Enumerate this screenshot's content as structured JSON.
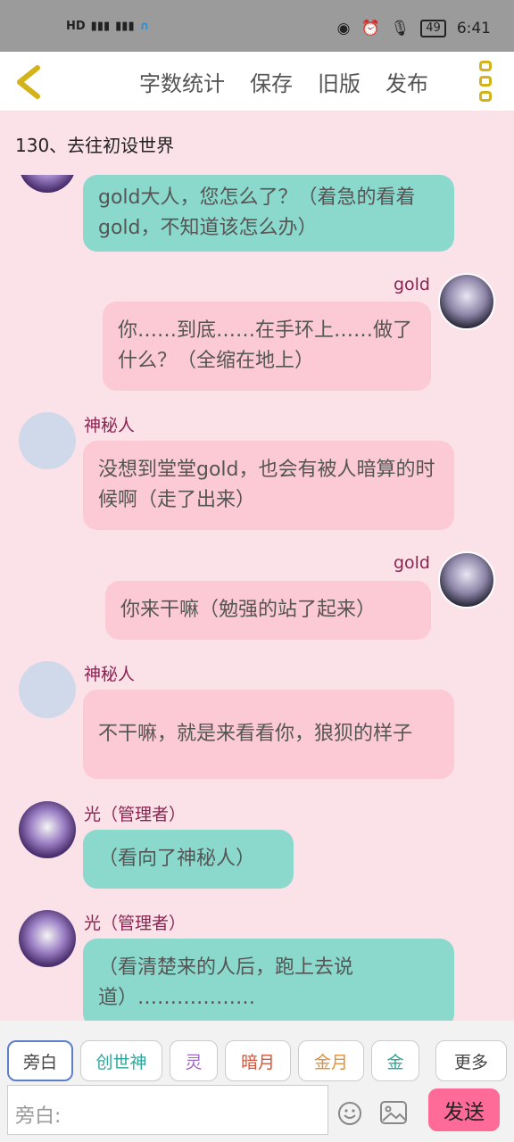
{
  "status": {
    "left": "HD",
    "time": "6:41",
    "battery": "49"
  },
  "toolbar": {
    "items": [
      "字数统计",
      "保存",
      "旧版",
      "发布"
    ]
  },
  "chapter": {
    "title": "130、去往初设世界"
  },
  "messages": [
    {
      "side": "left",
      "name": "",
      "text": "gold大人，您怎么了？（着急的看着gold，不知道该怎么办）",
      "color": "teal"
    },
    {
      "side": "right",
      "name": "gold",
      "text": "你……到底……在手环上……做了什么？（全缩在地上）",
      "color": "pink"
    },
    {
      "side": "left",
      "name": "神秘人",
      "text": "没想到堂堂gold，也会有被人暗算的时候啊（走了出来）",
      "color": "pink"
    },
    {
      "side": "right",
      "name": "gold",
      "text": "你来干嘛（勉强的站了起来）",
      "color": "pink"
    },
    {
      "side": "left",
      "name": "神秘人",
      "text": "不干嘛，就是来看看你，狼狈的样子",
      "color": "pink"
    },
    {
      "side": "left",
      "name": "光（管理者）",
      "text": "（看向了神秘人）",
      "color": "teal"
    },
    {
      "side": "left",
      "name": "光（管理者）",
      "text": "（看清楚来的人后，跑上去说道）………………",
      "color": "teal"
    }
  ],
  "roles": [
    {
      "label": "旁白",
      "color": "#444444"
    },
    {
      "label": "创世神",
      "color": "#2ea59a"
    },
    {
      "label": "灵",
      "color": "#a067c9"
    },
    {
      "label": "暗月",
      "color": "#d5553a"
    },
    {
      "label": "金月",
      "color": "#e0913a"
    },
    {
      "label": "金",
      "color": "#2ea59a"
    }
  ],
  "more_label": "更多",
  "input": {
    "placeholder": "旁白:"
  },
  "send_label": "发送",
  "colors": {
    "teal": "#8ad9cc",
    "pink": "#fccad4",
    "accent": "#ff6b99",
    "back": "#d4b21a"
  }
}
